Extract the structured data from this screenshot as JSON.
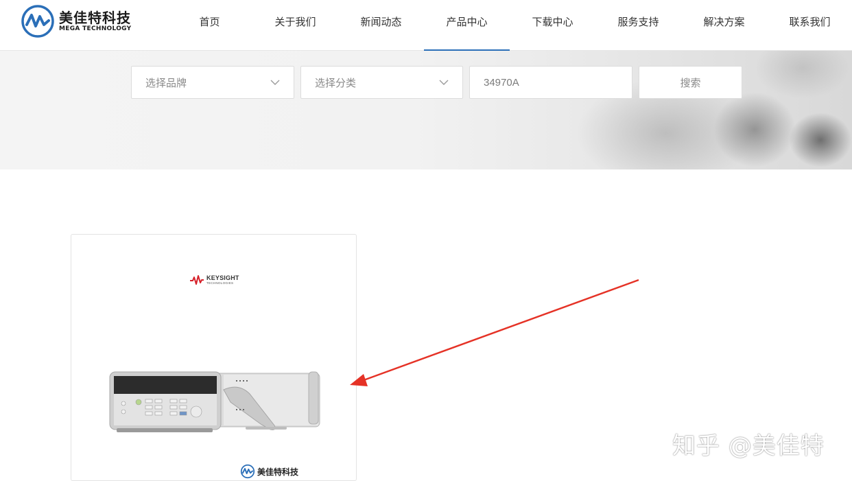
{
  "brand": {
    "name_cn": "美佳特科技",
    "name_en": "MEGA TECHNOLOGY",
    "accent_color": "#2b6fb8",
    "icon": "mega-technology-logo-icon"
  },
  "nav": {
    "items": [
      {
        "label": "首页"
      },
      {
        "label": "关于我们"
      },
      {
        "label": "新闻动态"
      },
      {
        "label": "产品中心",
        "active": true
      },
      {
        "label": "下载中心"
      },
      {
        "label": "服务支持"
      },
      {
        "label": "解决方案"
      },
      {
        "label": "联系我们"
      }
    ]
  },
  "search": {
    "brand_select": "选择品牌",
    "category_select": "选择分类",
    "keyword_value": "34970A",
    "button_label": "搜索",
    "dropdown_icon": "chevron-down-icon"
  },
  "product_card": {
    "maker_name": "KEYSIGHT",
    "maker_sub": "TECHNOLOGIES",
    "maker_icon": "keysight-wave-icon",
    "footer_brand": "美佳特科技",
    "annotation_color": "#e53226"
  },
  "watermark": {
    "text": "知乎 @美佳特"
  }
}
